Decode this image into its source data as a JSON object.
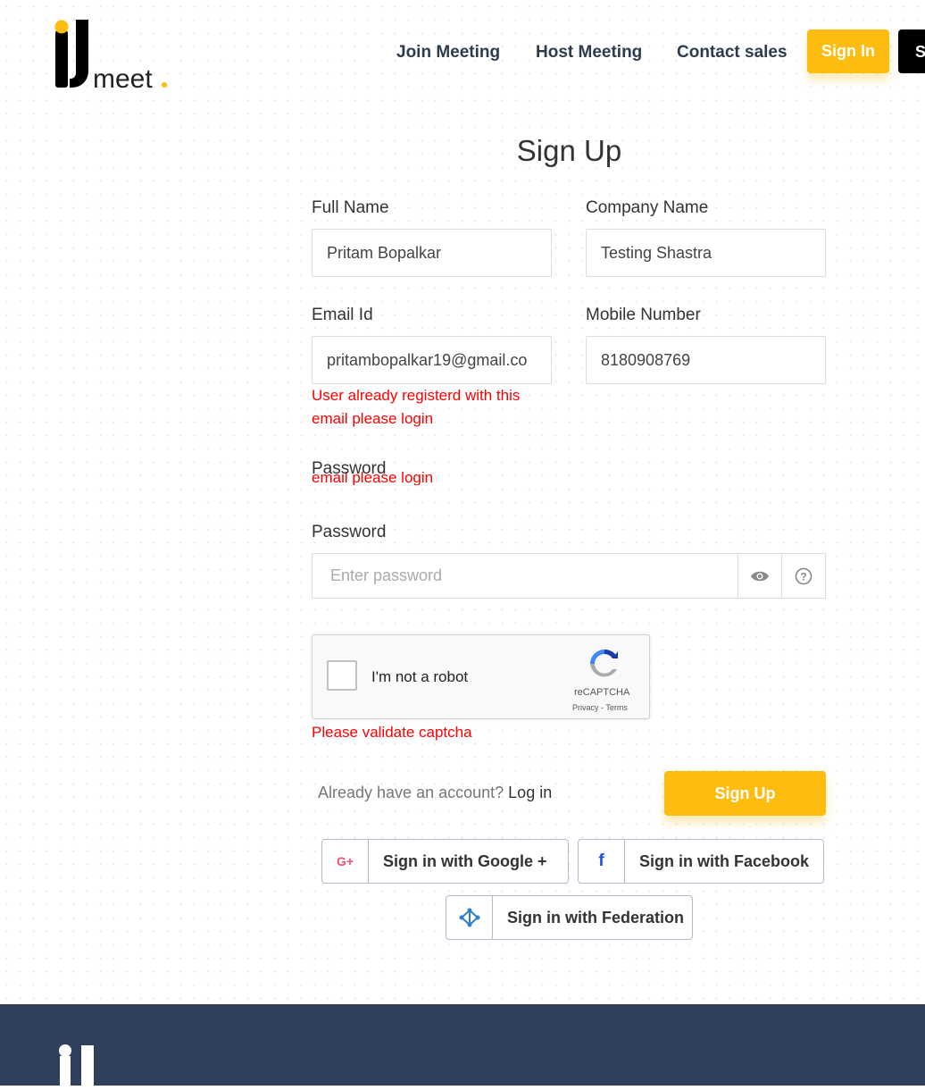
{
  "header": {
    "logo_text": "iJmeet",
    "nav": [
      "Join Meeting",
      "Host Meeting",
      "Contact sales"
    ],
    "signin_label": "Sign In",
    "signup_partial": "S"
  },
  "form": {
    "title": "Sign Up",
    "full_name": {
      "label": "Full Name",
      "value": "Pritam Bopalkar"
    },
    "company": {
      "label": "Company Name",
      "value": "Testing Shastra"
    },
    "email": {
      "label": "Email Id",
      "value": "pritambopalkar19@gmail.co",
      "error_line1": "User already registerd with this",
      "error_line2": "email please login"
    },
    "mobile": {
      "label": "Mobile Number",
      "value": "8180908769"
    },
    "password_label_overlap": "Password",
    "overlap_error": "email please login",
    "password": {
      "label": "Password",
      "placeholder": "Enter password"
    },
    "captcha": {
      "label": "I'm not a robot",
      "brand": "reCAPTCHA",
      "links": "Privacy - Terms",
      "error": "Please validate captcha"
    },
    "login_prompt": "Already have an account?",
    "login_link": "Log in",
    "submit": "Sign Up",
    "social": {
      "google": "Sign in with Google +",
      "google_icon": "G+",
      "facebook": "Sign in with Facebook",
      "facebook_icon": "f",
      "federation": "Sign in with Federation"
    }
  },
  "colors": {
    "accent": "#fdbd10",
    "error": "#ff0000",
    "footer": "#30405c"
  }
}
